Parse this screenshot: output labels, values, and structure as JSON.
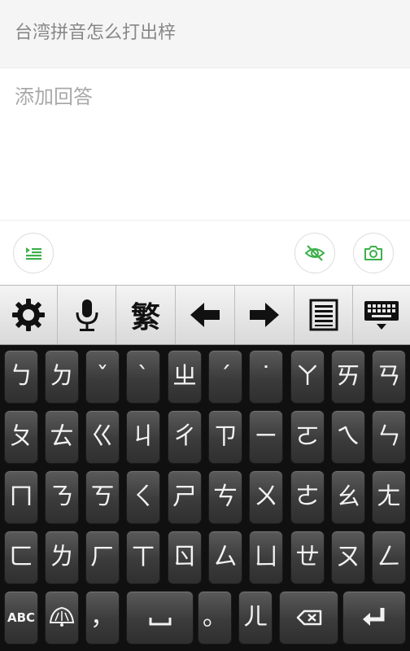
{
  "question": {
    "title": "台湾拼音怎么打出梓"
  },
  "answer": {
    "placeholder": "添加回答"
  },
  "actions": {
    "format_icon": "indent-list-icon",
    "visibility_icon": "eye-off-icon",
    "camera_icon": "camera-icon",
    "accent_color": "#3db04b"
  },
  "toolbar": {
    "traditional_label": "繁",
    "icons": [
      "gear-icon",
      "microphone-icon",
      "traditional-chinese-toggle",
      "arrow-left-icon",
      "arrow-right-icon",
      "clipboard-icon",
      "keyboard-hide-icon"
    ]
  },
  "keyboard": {
    "rows": [
      [
        "ㄅ",
        "ㄉ",
        "ˇ",
        "ˋ",
        "ㄓ",
        "ˊ",
        "˙",
        "ㄚ",
        "ㄞ",
        "ㄢ"
      ],
      [
        "ㄆ",
        "ㄊ",
        "ㄍ",
        "ㄐ",
        "ㄔ",
        "ㄗ",
        "ㄧ",
        "ㄛ",
        "ㄟ",
        "ㄣ"
      ],
      [
        "ㄇ",
        "ㄋ",
        "ㄎ",
        "ㄑ",
        "ㄕ",
        "ㄘ",
        "ㄨ",
        "ㄜ",
        "ㄠ",
        "ㄤ"
      ],
      [
        "ㄈ",
        "ㄌ",
        "ㄏ",
        "ㄒ",
        "ㄖ",
        "ㄙ",
        "ㄩ",
        "ㄝ",
        "ㄡ",
        "ㄥ"
      ]
    ],
    "bottom": {
      "abc": "ABC",
      "comma": "，",
      "period": "。",
      "er": "ㄦ"
    }
  }
}
